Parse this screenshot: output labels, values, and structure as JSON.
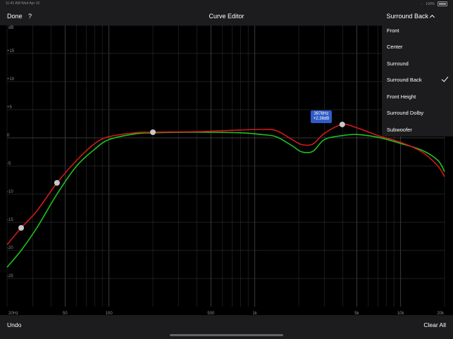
{
  "status": {
    "time": "11:41 AM",
    "date": "Wed Apr 10",
    "battery": "100%"
  },
  "nav": {
    "done": "Done",
    "help": "?",
    "title": "Curve Editor",
    "selected_output": "Surround Back"
  },
  "dropdown": {
    "items": [
      {
        "label": "Front",
        "selected": false
      },
      {
        "label": "Center",
        "selected": false
      },
      {
        "label": "Surround",
        "selected": false
      },
      {
        "label": "Surround Back",
        "selected": true
      },
      {
        "label": "Front Height",
        "selected": false
      },
      {
        "label": "Surround Dolby",
        "selected": false
      },
      {
        "label": "Subwoofer",
        "selected": false
      }
    ]
  },
  "graph": {
    "y_unit": "dB",
    "y_ticks": [
      "+15",
      "+10",
      "+5",
      "0",
      "-5",
      "-10",
      "-15",
      "-20",
      "-25"
    ],
    "y_range": [
      -30,
      20
    ],
    "x_ticks": [
      {
        "hz": 20,
        "label": "20Hz"
      },
      {
        "hz": 50,
        "label": "50"
      },
      {
        "hz": 100,
        "label": "100"
      },
      {
        "hz": 500,
        "label": "500"
      },
      {
        "hz": 1000,
        "label": "1k"
      },
      {
        "hz": 5000,
        "label": "5k"
      },
      {
        "hz": 10000,
        "label": "10k"
      },
      {
        "hz": 20000,
        "label": "20k"
      }
    ],
    "x_range": [
      20,
      20000
    ],
    "tooltip": {
      "freq": "3978Hz",
      "gain": "+2.38dB"
    },
    "colors": {
      "target": "#d11a1a",
      "measured": "#1ec31e",
      "grid": "#3a3a3c",
      "handle": "#c7c7cc"
    },
    "control_points": [
      {
        "hz": 25,
        "db": -16
      },
      {
        "hz": 44,
        "db": -8
      },
      {
        "hz": 200,
        "db": 1
      },
      {
        "hz": 3978,
        "db": 2.38
      }
    ],
    "target_curve": [
      [
        20,
        -19
      ],
      [
        25,
        -16
      ],
      [
        32,
        -13
      ],
      [
        44,
        -8
      ],
      [
        60,
        -4
      ],
      [
        80,
        -1
      ],
      [
        100,
        0.2
      ],
      [
        150,
        0.9
      ],
      [
        200,
        1
      ],
      [
        400,
        1.1
      ],
      [
        800,
        1.4
      ],
      [
        1100,
        1.5
      ],
      [
        1400,
        1.3
      ],
      [
        1800,
        -0.3
      ],
      [
        2100,
        -1.2
      ],
      [
        2500,
        -1.1
      ],
      [
        3000,
        0.8
      ],
      [
        3978,
        2.38
      ],
      [
        5000,
        1.8
      ],
      [
        7000,
        0.4
      ],
      [
        10000,
        -0.8
      ],
      [
        14000,
        -2.5
      ],
      [
        18000,
        -5
      ],
      [
        20000,
        -6.9
      ]
    ],
    "measured_curve": [
      [
        20,
        -23
      ],
      [
        25,
        -20
      ],
      [
        32,
        -16
      ],
      [
        44,
        -10
      ],
      [
        60,
        -5
      ],
      [
        80,
        -2
      ],
      [
        100,
        -0.3
      ],
      [
        150,
        0.7
      ],
      [
        200,
        0.9
      ],
      [
        400,
        1
      ],
      [
        800,
        0.9
      ],
      [
        1100,
        0.6
      ],
      [
        1400,
        0.2
      ],
      [
        1800,
        -1.4
      ],
      [
        2100,
        -2.5
      ],
      [
        2500,
        -2.4
      ],
      [
        3000,
        -0.3
      ],
      [
        3978,
        0.4
      ],
      [
        5000,
        0.6
      ],
      [
        7000,
        0.1
      ],
      [
        10000,
        -1
      ],
      [
        14000,
        -2.2
      ],
      [
        18000,
        -4
      ],
      [
        20000,
        -6
      ]
    ]
  },
  "toolbar": {
    "undo": "Undo",
    "clear_all": "Clear All"
  }
}
